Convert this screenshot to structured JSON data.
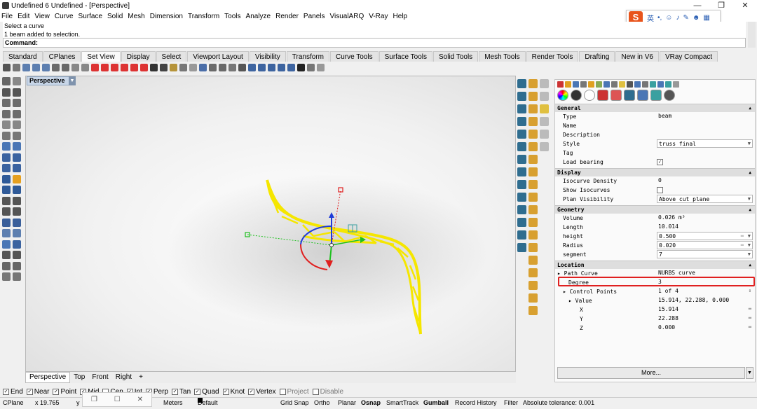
{
  "window": {
    "title": "Undefined 6 Undefined - [Perspective]",
    "controls": [
      "—",
      "❐",
      "✕"
    ]
  },
  "menu": [
    "File",
    "Edit",
    "View",
    "Curve",
    "Surface",
    "Solid",
    "Mesh",
    "Dimension",
    "Transform",
    "Tools",
    "Analyze",
    "Render",
    "Panels",
    "VisualARQ",
    "V-Ray",
    "Help"
  ],
  "ime": {
    "logo": "S",
    "lang": "英"
  },
  "command": {
    "history": [
      "Select a curve",
      "1 beam added to selection."
    ],
    "prompt": "Command:"
  },
  "toolbar_tabs": [
    "Standard",
    "CPlanes",
    "Set View",
    "Display",
    "Select",
    "Viewport Layout",
    "Visibility",
    "Transform",
    "Curve Tools",
    "Surface Tools",
    "Solid Tools",
    "Mesh Tools",
    "Render Tools",
    "Drafting",
    "New in V6",
    "VRay Compact"
  ],
  "active_toolbar_tab": "Set View",
  "viewport": {
    "name": "Perspective"
  },
  "viewport_tabs": [
    "Perspective",
    "Top",
    "Front",
    "Right"
  ],
  "active_viewport_tab": "Perspective",
  "properties": {
    "general": {
      "header": "General",
      "type_label": "Type",
      "type_value": "beam",
      "name_label": "Name",
      "description_label": "Description",
      "style_label": "Style",
      "style_value": "truss final",
      "tag_label": "Tag",
      "load_label": "Load bearing",
      "load_bearing": true
    },
    "display": {
      "header": "Display",
      "density_label": "Isocurve Density",
      "density_value": "0",
      "show_iso_label": "Show Isocurves",
      "show_isocurves": false,
      "plan_label": "Plan Visibility",
      "plan_value": "Above cut plane"
    },
    "geometry": {
      "header": "Geometry",
      "volume_label": "Volume",
      "volume_value": "0.026 m³",
      "length_label": "Length",
      "length_value": "10.014",
      "height_label": "height",
      "height_value": "0.500",
      "radius_label": "Radius",
      "radius_value": "0.020",
      "segment_label": "segment",
      "segment_value": "7"
    },
    "location": {
      "header": "Location",
      "path_label": "Path Curve",
      "path_value": "NURBS curve",
      "degree_label": "Degree",
      "degree_value": "3",
      "cp_label": "Control Points",
      "cp_value": "1 of 4",
      "value_label": "Value",
      "value_value": "15.914, 22.288, 0.000",
      "x_label": "X",
      "x_value": "15.914",
      "y_label": "Y",
      "y_value": "22.288",
      "z_label": "Z",
      "z_value": "0.000"
    },
    "more_label": "More..."
  },
  "osnap": [
    {
      "label": "End",
      "checked": true
    },
    {
      "label": "Near",
      "checked": true
    },
    {
      "label": "Point",
      "checked": true
    },
    {
      "label": "Mid",
      "checked": true
    },
    {
      "label": "Cen",
      "checked": false
    },
    {
      "label": "Int",
      "checked": true
    },
    {
      "label": "Perp",
      "checked": true
    },
    {
      "label": "Tan",
      "checked": true
    },
    {
      "label": "Quad",
      "checked": true
    },
    {
      "label": "Knot",
      "checked": true
    },
    {
      "label": "Vertex",
      "checked": true
    },
    {
      "label": "Project",
      "checked": false
    },
    {
      "label": "Disable",
      "checked": false
    }
  ],
  "status": {
    "cplane": "CPlane",
    "x": "x 19.765",
    "y": "y",
    "units": "Meters",
    "layer": "Default",
    "grid_snap": "Grid Snap",
    "ortho": "Ortho",
    "planar": "Planar",
    "osnap": "Osnap",
    "smarttrack": "SmartTrack",
    "gumball": "Gumball",
    "record_history": "Record History",
    "filter": "Filter",
    "tolerance": "Absolute tolerance: 0.001"
  },
  "colors": {
    "beam": "#f5e600",
    "highlight": "#e02020",
    "gumball_x": "#e02020",
    "gumball_y": "#1ec01e",
    "gumball_z": "#1f3bd8"
  }
}
